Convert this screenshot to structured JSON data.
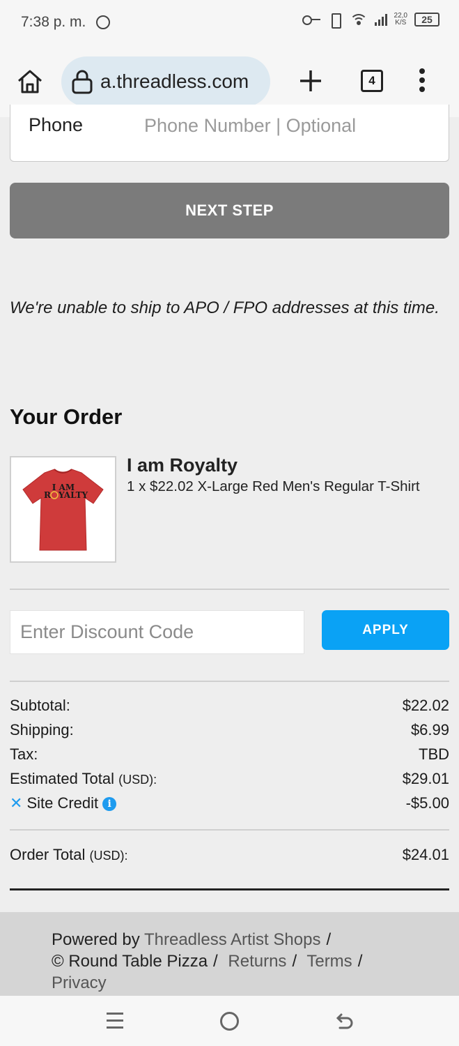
{
  "status_bar": {
    "time": "7:38 p. m.",
    "network_speed": "22,0",
    "network_unit": "K/S",
    "battery": "25"
  },
  "browser": {
    "url": "a.threadless.com",
    "tab_count": "4"
  },
  "phone_field": {
    "label": "Phone",
    "placeholder": "Phone Number | Optional"
  },
  "next_step_label": "NEXT STEP",
  "apo_notice": "We're unable to ship to APO / FPO addresses at this time.",
  "order": {
    "title": "Your Order",
    "product": {
      "name": "I am Royalty",
      "detail": "1 x $22.02 X-Large Red Men's Regular T-Shirt",
      "shirt_text_line1": "I AM",
      "shirt_text_line2": "R",
      "shirt_text_line2_rest": "YALTY",
      "shirt_color": "#cf3b3b"
    },
    "discount": {
      "placeholder": "Enter Discount Code",
      "apply_label": "APPLY"
    },
    "summary": {
      "subtotal_label": "Subtotal:",
      "subtotal_value": "$22.02",
      "shipping_label": "Shipping:",
      "shipping_value": "$6.99",
      "tax_label": "Tax:",
      "tax_value": "TBD",
      "estimated_label": "Estimated Total",
      "estimated_currency": "(USD):",
      "estimated_value": "$29.01",
      "credit_label": "Site Credit",
      "credit_value": "-$5.00",
      "order_total_label": "Order Total",
      "order_total_currency": "(USD):",
      "order_total_value": "$24.01"
    }
  },
  "footer": {
    "powered_by": "Powered by",
    "powered_link": "Threadless Artist Shops",
    "copyright": "© Round Table Pizza",
    "returns": "Returns",
    "terms": "Terms",
    "privacy": "Privacy",
    "separator": "/"
  },
  "colors": {
    "accent": "#0aa2f5",
    "next_step_bg": "#7b7b7b",
    "url_pill": "#dde9f1"
  }
}
